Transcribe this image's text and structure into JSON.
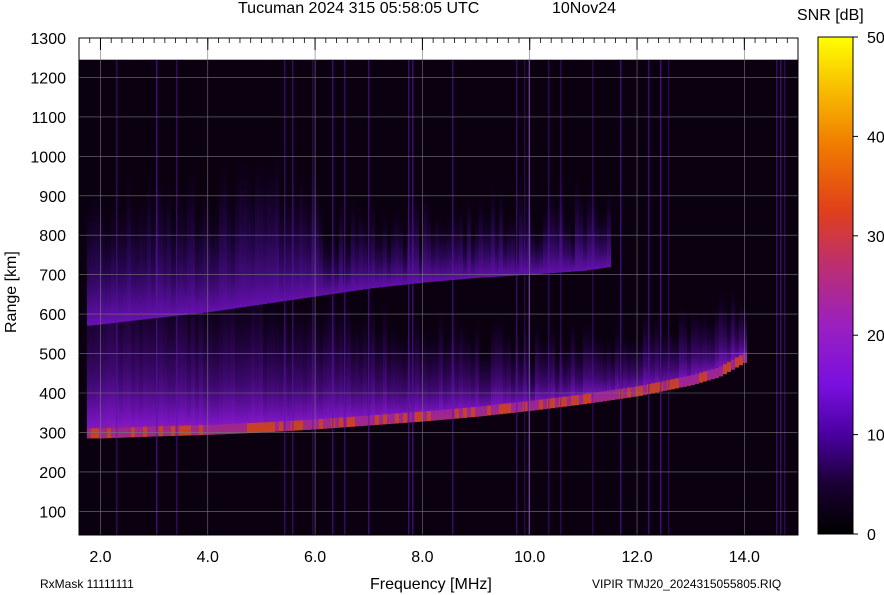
{
  "chart_data": {
    "type": "heatmap",
    "title": "Tucuman 2024 315 05:58:05 UTC",
    "date_label": "10Nov24",
    "xlabel": "Frequency [MHz]",
    "ylabel": "Range [km]",
    "colorbar_label": "SNR [dB]",
    "xlim": [
      1.6,
      15.0
    ],
    "ylim": [
      40,
      1300
    ],
    "x_ticks": [
      2.0,
      4.0,
      6.0,
      8.0,
      10.0,
      12.0,
      14.0
    ],
    "x_tick_labels": [
      "2.0",
      "4.0",
      "6.0",
      "8.0",
      "10.0",
      "12.0",
      "14.0"
    ],
    "y_ticks": [
      100,
      200,
      300,
      400,
      500,
      600,
      700,
      800,
      900,
      1000,
      1100,
      1200,
      1300
    ],
    "y_tick_labels": [
      "100",
      "200",
      "300",
      "400",
      "500",
      "600",
      "700",
      "800",
      "900",
      "1000",
      "1100",
      "1200",
      "1300"
    ],
    "colorbar_range": [
      0,
      50
    ],
    "colorbar_ticks": [
      0,
      10,
      20,
      30,
      40,
      50
    ],
    "colorbar_tick_labels": [
      "0",
      "10",
      "20",
      "30",
      "40",
      "50"
    ],
    "data_top_km": 1245,
    "grid": true,
    "traces": [
      {
        "name": "",
        "x": [
          1.7,
          2.0,
          3.0,
          4.0,
          5.0,
          6.0,
          7.0,
          8.0,
          9.0,
          10.0,
          11.0,
          12.0,
          13.0,
          13.5,
          14.0
        ],
        "y": [
          285,
          285,
          290,
          294,
          300,
          308,
          318,
          328,
          340,
          355,
          372,
          392,
          420,
          440,
          478
        ]
      },
      {
        "name": "",
        "x": [
          1.7,
          2.0,
          3.0,
          4.0,
          5.0,
          6.0,
          7.0,
          8.0,
          9.0,
          10.0,
          11.0,
          11.5
        ],
        "y": [
          570,
          574,
          590,
          605,
          625,
          645,
          665,
          680,
          692,
          700,
          710,
          720
        ]
      }
    ]
  },
  "footer": {
    "rx_mask": "RxMask 11111111",
    "file_label": "VIPIR  TMJ20_2024315055805.RIQ"
  }
}
